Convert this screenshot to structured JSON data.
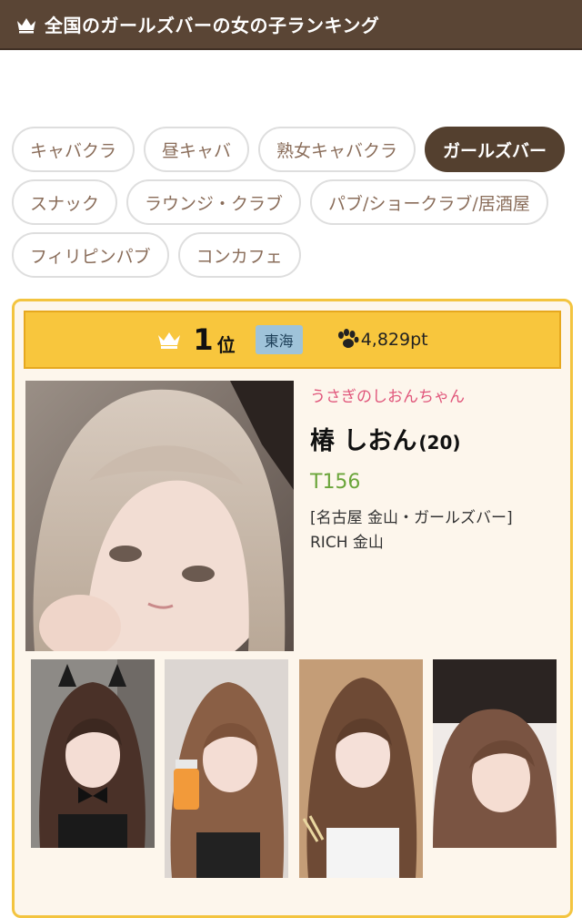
{
  "header": {
    "title": "全国のガールズバーの女の子ランキング",
    "icon": "crown-icon"
  },
  "categories": [
    {
      "label": "キャバクラ",
      "active": false
    },
    {
      "label": "昼キャバ",
      "active": false
    },
    {
      "label": "熟女キャバクラ",
      "active": false
    },
    {
      "label": "ガールズバー",
      "active": true
    },
    {
      "label": "スナック",
      "active": false
    },
    {
      "label": "ラウンジ・クラブ",
      "active": false
    },
    {
      "label": "パブ/ショークラブ/居酒屋",
      "active": false
    },
    {
      "label": "フィリピンパブ",
      "active": false
    },
    {
      "label": "コンカフェ",
      "active": false
    }
  ],
  "ranking_card": {
    "rank_number": "1",
    "rank_suffix": "位",
    "region": "東海",
    "points": "4,829pt",
    "catchphrase": "うさぎのしおんちゃん",
    "name": "椿 しおん",
    "age": "(20)",
    "height": "T156",
    "shop_line1": "[名古屋 金山・ガールズバー]",
    "shop_line2": "RICH 金山"
  },
  "colors": {
    "header_bg": "#5a4535",
    "accent_yellow": "#f8c63d",
    "chip_text": "#8a6d5a",
    "catch_pink": "#e0557a",
    "height_green": "#6aa53a",
    "region_badge": "#9fc3d9"
  }
}
